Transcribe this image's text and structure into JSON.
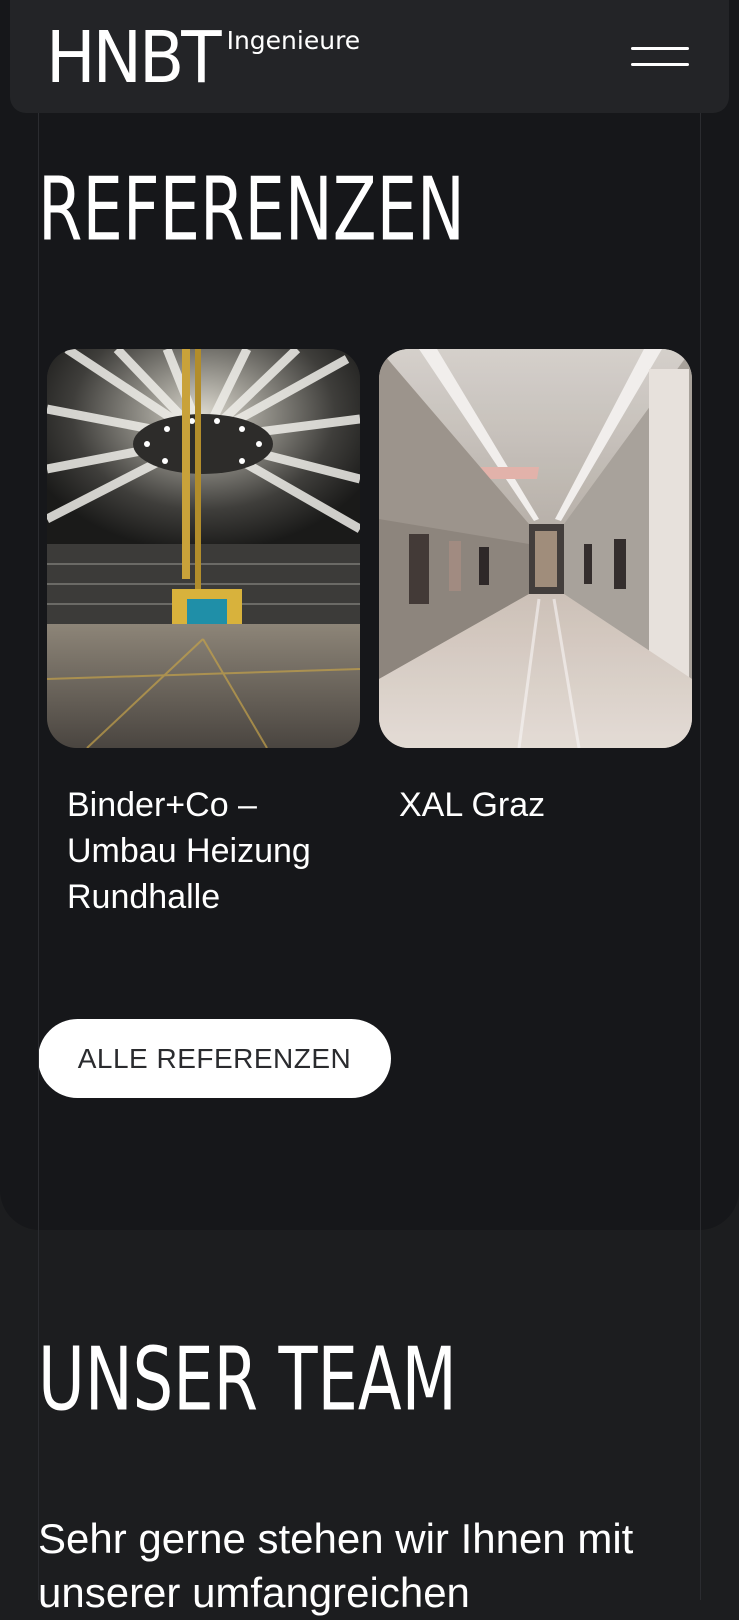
{
  "header": {
    "logo_main": "HNBT",
    "logo_sub": "Ingenieure",
    "menu_icon": "hamburger-menu-icon"
  },
  "references": {
    "title": "REFERENZEN",
    "items": [
      {
        "caption": "Binder+Co – Umbau Heizung Rundhalle",
        "image_icon": "round-hall-photo"
      },
      {
        "caption": "XAL Graz",
        "image_icon": "hallway-photo"
      }
    ],
    "cta_label": "ALLE REFERENZEN"
  },
  "team": {
    "title": "UNSER TEAM",
    "intro": "Sehr gerne stehen wir Ihnen mit unserer umfangreichen"
  },
  "colors": {
    "page_background": "#1c1d1f",
    "card_background": "#16171a",
    "header_background": "#232427",
    "cta_background": "#ffffff",
    "cta_text": "#2a2b2e",
    "text": "#ffffff"
  }
}
